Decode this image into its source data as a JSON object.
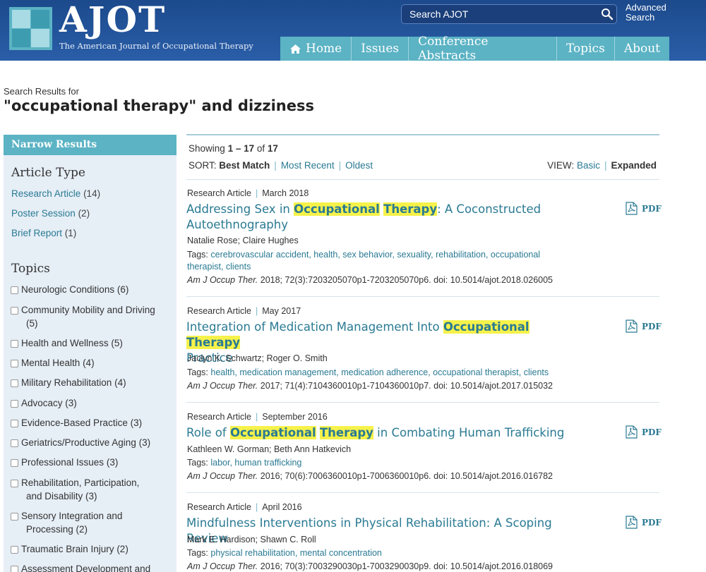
{
  "header": {
    "logo_text": "AJOT",
    "logo_subtitle": "The American Journal of Occupational Therapy",
    "search_placeholder": "Search AJOT",
    "advanced_line1": "Advanced",
    "advanced_line2": "Search",
    "nav": [
      "Home",
      "Issues",
      "Conference Abstracts",
      "Topics",
      "About"
    ]
  },
  "colors": {
    "header_bg": "#1c4a8c",
    "accent_teal": "#5bb3c4",
    "link": "#2a7a93",
    "highlight": "#f6f24a",
    "sidebar_bg": "#e6eef6"
  },
  "search": {
    "results_for": "Search Results for",
    "query": "\"occupational therapy\" and dizziness"
  },
  "sidebar": {
    "title": "Narrow Results",
    "article_type_heading": "Article Type",
    "article_types": [
      {
        "label": "Research Article",
        "count": "(14)"
      },
      {
        "label": "Poster Session",
        "count": "(2)"
      },
      {
        "label": "Brief Report",
        "count": "(1)"
      }
    ],
    "topics_heading": "Topics",
    "topics": [
      {
        "line1": "Neurologic Conditions",
        "count": "(6)",
        "line2": ""
      },
      {
        "line1": "Community Mobility and Driving",
        "count": "",
        "line2": "(5)"
      },
      {
        "line1": "Health and Wellness",
        "count": "(5)",
        "line2": ""
      },
      {
        "line1": "Mental Health",
        "count": "(4)",
        "line2": ""
      },
      {
        "line1": "Military Rehabilitation",
        "count": "(4)",
        "line2": ""
      },
      {
        "line1": "Advocacy",
        "count": "(3)",
        "line2": ""
      },
      {
        "line1": "Evidence-Based Practice",
        "count": "(3)",
        "line2": ""
      },
      {
        "line1": "Geriatrics/Productive Aging",
        "count": "(3)",
        "line2": ""
      },
      {
        "line1": "Professional Issues",
        "count": "(3)",
        "line2": ""
      },
      {
        "line1": "Rehabilitation, Participation,",
        "count": "",
        "line2": "and Disability (3)"
      },
      {
        "line1": "Sensory Integration and",
        "count": "",
        "line2": "Processing (2)"
      },
      {
        "line1": "Traumatic Brain Injury",
        "count": "(2)",
        "line2": ""
      },
      {
        "line1": "Assessment Development and",
        "count": "",
        "line2": ""
      }
    ]
  },
  "results": {
    "showing_prefix": "Showing",
    "showing_range": "1 – 17",
    "showing_of": "of",
    "showing_total": "17",
    "sort_label": "SORT:",
    "sort_active": "Best Match",
    "sort_options": [
      "Most Recent",
      "Oldest"
    ],
    "view_label": "VIEW:",
    "view_basic": "Basic",
    "view_expanded": "Expanded",
    "pdf_label": "PDF",
    "articles": [
      {
        "type": "Research Article",
        "date": "March 2018",
        "title_pre": "Addressing Sex in ",
        "hl1": "Occupational",
        "hl2": "Therapy",
        "title_post": ": A Coconstructed",
        "title_line2": "Autoethnography",
        "authors": "Natalie Rose; Claire Hughes",
        "tags_label": "Tags:",
        "tags_line1": "cerebrovascular accident, health, sex behavior, sexuality, rehabilitation, occupational",
        "tags_line2": "therapist, clients",
        "journal": "Am J Occup Ther.",
        "citation": "2018; 72(3):7203205070p1-7203205070p6. doi: 10.5014/ajot.2018.026005"
      },
      {
        "type": "Research Article",
        "date": "May 2017",
        "title_pre": "Integration of Medication Management Into ",
        "hl1": "Occupational",
        "hl2": "Therapy",
        "title_post": "",
        "title_line2": "Practice",
        "authors": "Jaclyn K. Schwartz; Roger O. Smith",
        "tags_label": "Tags:",
        "tags_line1": "health, medication management, medication adherence, occupational therapist, clients",
        "tags_line2": "",
        "journal": "Am J Occup Ther.",
        "citation": "2017; 71(4):7104360010p1-7104360010p7. doi: 10.5014/ajot.2017.015032"
      },
      {
        "type": "Research Article",
        "date": "September 2016",
        "title_pre": "Role of ",
        "hl1": "Occupational",
        "hl2": "Therapy",
        "title_post": " in Combating Human Trafficking",
        "title_line2": "",
        "authors": "Kathleen W. Gorman; Beth Ann Hatkevich",
        "tags_label": "Tags:",
        "tags_line1": "labor, human trafficking",
        "tags_line2": "",
        "journal": "Am J Occup Ther.",
        "citation": "2016; 70(6):7006360010p1-7006360010p6. doi: 10.5014/ajot.2016.016782"
      },
      {
        "type": "Research Article",
        "date": "April 2016",
        "title_pre": "Mindfulness Interventions in Physical Rehabilitation: A Scoping Review",
        "hl1": "",
        "hl2": "",
        "title_post": "",
        "title_line2": "",
        "authors": "Mark E. Hardison; Shawn C. Roll",
        "tags_label": "Tags:",
        "tags_line1": "physical rehabilitation, mental concentration",
        "tags_line2": "",
        "journal": "Am J Occup Ther.",
        "citation": "2016; 70(3):7003290030p1-7003290030p9. doi: 10.5014/ajot.2016.018069"
      }
    ]
  }
}
